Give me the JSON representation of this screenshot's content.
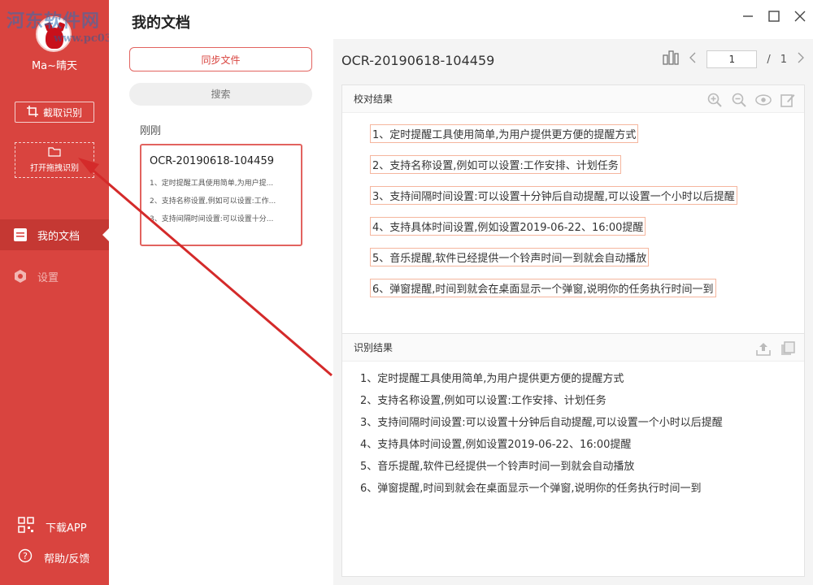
{
  "window": {
    "title": "我的文档"
  },
  "user": {
    "name": "Ma~晴天"
  },
  "watermark": {
    "line1": "河东软件网",
    "line2": "www.pc0359.cn"
  },
  "sidebar": {
    "capture_label": "截取识别",
    "open_label": "打开拖拽识别",
    "nav": [
      {
        "label": "我的文档",
        "icon": "document-icon",
        "active": true
      },
      {
        "label": "设置",
        "icon": "gear-icon",
        "active": false
      }
    ],
    "download_app": "下载APP",
    "help": "帮助/反馈"
  },
  "middle": {
    "sync_label": "同步文件",
    "search_placeholder": "搜索",
    "section": "刚刚",
    "card": {
      "title": "OCR-20190618-104459",
      "lines": [
        "1、定时提醒工具使用简单,为用户提...",
        "2、支持名称设置,例如可以设置:工作...",
        "3、支持间隔时间设置:可以设置十分..."
      ]
    }
  },
  "viewer": {
    "file_name": "OCR-20190618-104459",
    "page_current": "1",
    "page_sep": "/",
    "page_total": "1"
  },
  "proofread": {
    "title": "校对结果",
    "lines": [
      "1、定时提醒工具使用简单,为用户提供更方便的提醒方式",
      "2、支持名称设置,例如可以设置:工作安排、计划任务",
      "3、支持间隔时间设置:可以设置十分钟后自动提醒,可以设置一个小时以后提醒",
      "4、支持具体时间设置,例如设置2019-06-22、16:00提醒",
      "5、音乐提醒,软件已经提供一个铃声时间一到就会自动播放",
      "6、弹窗提醒,时间到就会在桌面显示一个弹窗,说明你的任务执行时间一到"
    ]
  },
  "recognition": {
    "title": "识别结果",
    "lines": [
      "1、定时提醒工具使用简单,为用户提供更方便的提醒方式",
      "2、支持名称设置,例如可以设置:工作安排、计划任务",
      "3、支持间隔时间设置:可以设置十分钟后自动提醒,可以设置一个小时以后提醒",
      "4、支持具体时间设置,例如设置2019-06-22、16:00提醒",
      "5、音乐提醒,软件已经提供一个铃声时间一到就会自动播放",
      "6、弹窗提醒,时间到就会在桌面显示一个弹窗,说明你的任务执行时间一到"
    ]
  },
  "colors": {
    "accent": "#d9443f",
    "annotation_arrow": "#d42a2a"
  }
}
